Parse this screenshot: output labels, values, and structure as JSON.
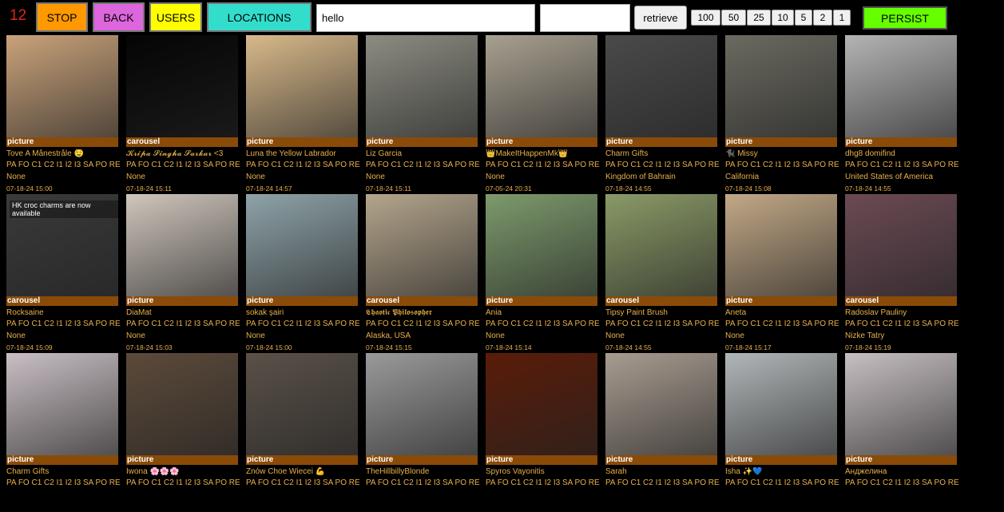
{
  "toolbar": {
    "counter": "12",
    "stop_label": "STOP",
    "back_label": "BACK",
    "users_label": "USERS",
    "locations_label": "LOCATIONS",
    "search_value": "hello",
    "second_value": "",
    "retrieve_label": "retrieve",
    "page_sizes": [
      "100",
      "50",
      "25",
      "10",
      "5",
      "2",
      "1"
    ],
    "persist_label": "PERSIST",
    "colors": {
      "stop": "#ff9900",
      "back": "#dd66dd",
      "users": "#ffff00",
      "locations": "#33ddcc",
      "persist": "#66ff00",
      "counter": "#e0241b"
    }
  },
  "cards": [
    {
      "type": "picture",
      "name": "Tove A Månestråle 🤤",
      "cats": "PA FO C1 C2 I1 I2 I3 SA PO RE",
      "location": "None",
      "date": "07-18-24 15:00",
      "thumb": "#c9a27a",
      "icon": "portrait-photo"
    },
    {
      "type": "carousel",
      "name": "𝓚𝓻𝓲𝓹𝓪 𝓢𝓲𝓷𝓰𝓱𝓪 𝓢𝓪𝓻𝓴𝓪𝓻 <3",
      "cats": "PA FO C1 C2 I1 I2 I3 SA PO RE",
      "location": "None",
      "date": "07-18-24 15:11",
      "thumb": "#050505",
      "icon": "blank-photo"
    },
    {
      "type": "picture",
      "name": "Luna the Yellow Labrador",
      "cats": "PA FO C1 C2 I1 I2 I3 SA PO RE",
      "location": "None",
      "date": "07-18-24 14:57",
      "thumb": "#d8b98a",
      "icon": "puppies-photo"
    },
    {
      "type": "picture",
      "name": "Liz Garcia",
      "cats": "PA FO C1 C2 I1 I2 I3 SA PO RE",
      "location": "None",
      "date": "07-18-24 15:11",
      "thumb": "#8c8c82",
      "icon": "pavement-photo"
    },
    {
      "type": "picture",
      "name": "👑MakeItHappenMk👑",
      "cats": "PA FO C1 C2 I1 I2 I3 SA PO RE",
      "location": "None",
      "date": "07-05-24 20:31",
      "thumb": "#a8a090",
      "icon": "kitchen-photo"
    },
    {
      "type": "picture",
      "name": "Charm Gifts",
      "cats": "PA FO C1 C2 I1 I2 I3 SA PO RE",
      "location": "Kingdom of Bahrain",
      "date": "07-18-24 14:55",
      "thumb": "#4a4a4a",
      "icon": "phone-case-photo"
    },
    {
      "type": "picture",
      "name": "🐈‍⬛ Missy",
      "cats": "PA FO C1 C2 I1 I2 I3 SA PO RE",
      "location": "California",
      "date": "07-18-24 15:08",
      "thumb": "#6b6a60",
      "icon": "cat-photo"
    },
    {
      "type": "picture",
      "name": "dhg8 domifind",
      "cats": "PA FO C1 C2 I1 I2 I3 SA PO RE",
      "location": "United States of America",
      "date": "07-18-24 14:55",
      "thumb": "#b4b4b4",
      "icon": "necklace-photo"
    },
    {
      "type": "carousel",
      "name": "Rocksaine",
      "cats": "PA FO C1 C2 I1 I2 I3 SA PO RE",
      "location": "None",
      "date": "07-18-24 15:09",
      "thumb": "#3a3a3a",
      "icon": "croc-charms-photo",
      "overlay": "HK croc charms are now available"
    },
    {
      "type": "picture",
      "name": "DiaMat",
      "cats": "PA FO C1 C2 I1 I2 I3 SA PO RE",
      "location": "None",
      "date": "07-18-24 15:03",
      "thumb": "#cfc6bc",
      "icon": "portrait-photo"
    },
    {
      "type": "picture",
      "name": "sokak şairi",
      "cats": "PA FO C1 C2 I1 I2 I3 SA PO RE",
      "location": "None",
      "date": "07-18-24 15:00",
      "thumb": "#8ea3a8",
      "icon": "street-photo"
    },
    {
      "type": "carousel",
      "name": "𝕮𝖍𝖆𝖔𝖙𝖎𝖈 𝕻𝖍𝖎𝖑𝖔𝖘𝖔𝖕𝖍𝖊𝖗",
      "cats": "PA FO C1 C2 I1 I2 I3 SA PO RE",
      "location": "Alaska, USA",
      "date": "07-18-24 15:15",
      "thumb": "#b4a58c",
      "icon": "selfie-photo"
    },
    {
      "type": "picture",
      "name": "Ania",
      "cats": "PA FO C1 C2 I1 I2 I3 SA PO RE",
      "location": "None",
      "date": "07-18-24 15:14",
      "thumb": "#7d9a6c",
      "icon": "lavender-photo"
    },
    {
      "type": "carousel",
      "name": "Tipsy Paint Brush",
      "cats": "PA FO C1 C2 I1 I2 I3 SA PO RE",
      "location": "None",
      "date": "07-18-24 14:55",
      "thumb": "#8a9a66",
      "icon": "garden-photo"
    },
    {
      "type": "picture",
      "name": "Aneta",
      "cats": "PA FO C1 C2 I1 I2 I3 SA PO RE",
      "location": "None",
      "date": "07-18-24 15:17",
      "thumb": "#c2a886",
      "icon": "portrait-photo"
    },
    {
      "type": "carousel",
      "name": "Radoslav Pauliny",
      "cats": "PA FO C1 C2 I1 I2 I3 SA PO RE",
      "location": "Nizke Tatry",
      "date": "07-18-24 15:19",
      "thumb": "#6c4a54",
      "icon": "sunset-photo"
    },
    {
      "type": "picture",
      "name": "Charm Gifts",
      "cats": "PA FO C1 C2 I1 I2 I3 SA PO RE",
      "location": "",
      "date": "",
      "thumb": "#c9bfc4",
      "icon": "phone-case-photo"
    },
    {
      "type": "picture",
      "name": "Iwona 🌸🌸🌸",
      "cats": "PA FO C1 C2 I1 I2 I3 SA PO RE",
      "location": "",
      "date": "",
      "thumb": "#5c4a3a",
      "icon": "sea-sunset-photo"
    },
    {
      "type": "picture",
      "name": "Znów Choe Wiecei 💪",
      "cats": "PA FO C1 C2 I1 I2 I3 SA PO RE",
      "location": "",
      "date": "",
      "thumb": "#5a5148",
      "icon": "portrait-photo"
    },
    {
      "type": "picture",
      "name": "TheHillbillyBlonde",
      "cats": "PA FO C1 C2 I1 I2 I3 SA PO RE",
      "location": "",
      "date": "",
      "thumb": "#9a9a9a",
      "icon": "hat-photo"
    },
    {
      "type": "picture",
      "name": "Spyros Vayonitis",
      "cats": "PA FO C1 C2 I1 I2 I3 SA PO RE",
      "location": "",
      "date": "",
      "thumb": "#5a1c08",
      "icon": "sunset-tree-photo"
    },
    {
      "type": "picture",
      "name": "Sarah",
      "cats": "PA FO C1 C2 I1 I2 I3 SA PO RE",
      "location": "",
      "date": "",
      "thumb": "#a89c90",
      "icon": "portrait-photo"
    },
    {
      "type": "picture",
      "name": "Isha ✨💙",
      "cats": "PA FO C1 C2 I1 I2 I3 SA PO RE",
      "location": "",
      "date": "",
      "thumb": "#b1b6b8",
      "icon": "portrait-photo"
    },
    {
      "type": "picture",
      "name": "Анджелина",
      "cats": "PA FO C1 C2 I1 I2 I3 SA PO RE",
      "location": "",
      "date": "",
      "thumb": "#c7bfc2",
      "icon": "selfie-photo"
    }
  ]
}
